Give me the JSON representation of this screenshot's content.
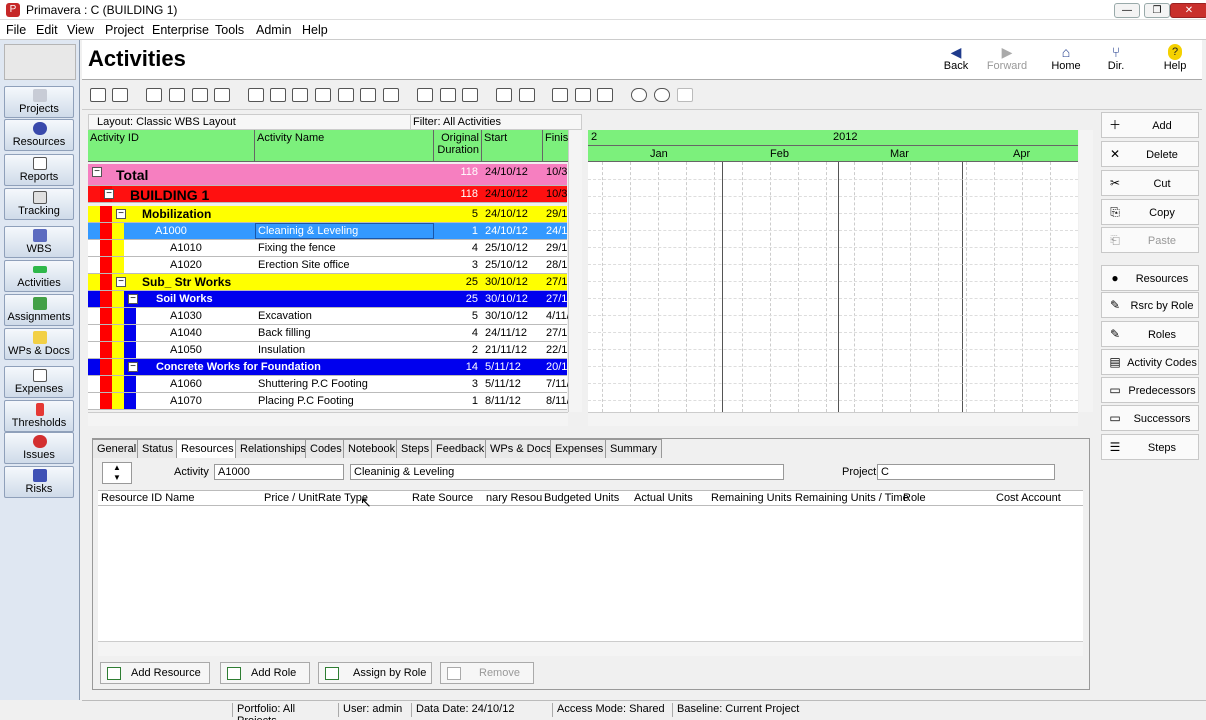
{
  "window": {
    "title": "Primavera : C (BUILDING 1)"
  },
  "menu": [
    "File",
    "Edit",
    "View",
    "Project",
    "Enterprise",
    "Tools",
    "Admin",
    "Help"
  ],
  "sidebar": [
    "Projects",
    "Resources",
    "Reports",
    "Tracking",
    "WBS",
    "Activities",
    "Assignments",
    "WPs & Docs",
    "Expenses",
    "Thresholds",
    "Issues",
    "Risks"
  ],
  "header": {
    "title": "Activities",
    "nav": [
      "Back",
      "Forward",
      "Home",
      "Dir.",
      "Help"
    ]
  },
  "layout": {
    "label": "Layout: Classic WBS Layout",
    "filter": "Filter: All Activities"
  },
  "grid": {
    "columns": [
      "Activity ID",
      "Activity Name",
      "Original Duration",
      "Start",
      "Finis"
    ],
    "rows": [
      {
        "id": "Total",
        "name": "",
        "dur": "118",
        "start": "24/10/12",
        "fin": "10/3"
      },
      {
        "id": "BUILDING 1",
        "name": "",
        "dur": "118",
        "start": "24/10/12",
        "fin": "10/3"
      },
      {
        "id": "Mobilization",
        "name": "",
        "dur": "5",
        "start": "24/10/12",
        "fin": "29/1"
      },
      {
        "id": "A1000",
        "name": "Cleaninig & Leveling",
        "dur": "1",
        "start": "24/10/12",
        "fin": "24/1"
      },
      {
        "id": "A1010",
        "name": "Fixing the fence",
        "dur": "4",
        "start": "25/10/12",
        "fin": "29/1"
      },
      {
        "id": "A1020",
        "name": "Erection Site office",
        "dur": "3",
        "start": "25/10/12",
        "fin": "28/1"
      },
      {
        "id": "Sub_ Str Works",
        "name": "",
        "dur": "25",
        "start": "30/10/12",
        "fin": "27/1"
      },
      {
        "id": "Soil Works",
        "name": "",
        "dur": "25",
        "start": "30/10/12",
        "fin": "27/1"
      },
      {
        "id": "A1030",
        "name": "Excavation",
        "dur": "5",
        "start": "30/10/12",
        "fin": "4/11/"
      },
      {
        "id": "A1040",
        "name": "Back filling",
        "dur": "4",
        "start": "24/11/12",
        "fin": "27/1"
      },
      {
        "id": "A1050",
        "name": "Insulation",
        "dur": "2",
        "start": "21/11/12",
        "fin": "22/1"
      },
      {
        "id": "Concrete Works for Foundation",
        "name": "",
        "dur": "14",
        "start": "5/11/12",
        "fin": "20/1"
      },
      {
        "id": "A1060",
        "name": "Shuttering P.C Footing",
        "dur": "3",
        "start": "5/11/12",
        "fin": "7/11/"
      },
      {
        "id": "A1070",
        "name": "Placing P.C Footing",
        "dur": "1",
        "start": "8/11/12",
        "fin": "8/11/"
      }
    ]
  },
  "gantt": {
    "year": "2012",
    "year_left": "2",
    "months": [
      "Jan",
      "Feb",
      "Mar",
      "Apr"
    ]
  },
  "detail": {
    "tabs": [
      "General",
      "Status",
      "Resources",
      "Relationships",
      "Codes",
      "Notebook",
      "Steps",
      "Feedback",
      "WPs & Docs",
      "Expenses",
      "Summary"
    ],
    "activity_label": "Activity",
    "activity_id": "A1000",
    "activity_name": "Cleaninig & Leveling",
    "project_label": "Project",
    "project": "C",
    "columns": [
      "Resource ID Name",
      "Price / Unit",
      "Rate Type",
      "Rate Source",
      "nary Resou",
      "Budgeted Units",
      "Actual Units",
      "Remaining Units",
      "Remaining Units / Time",
      "Role",
      "Cost Account"
    ],
    "buttons": [
      "Add Resource",
      "Add Role",
      "Assign by Role",
      "Remove"
    ]
  },
  "actions": [
    "Add",
    "Delete",
    "Cut",
    "Copy",
    "Paste",
    "Resources",
    "Rsrc by Role",
    "Roles",
    "Activity Codes",
    "Predecessors",
    "Successors",
    "Steps"
  ],
  "status": {
    "portfolio": "Portfolio: All Projects",
    "user": "User: admin",
    "date": "Data Date: 24/10/12",
    "access": "Access Mode: Shared",
    "baseline": "Baseline: Current Project"
  },
  "colors": {
    "total": "#f67fc0",
    "building": "#ff1010",
    "mobilization": "#ffff00",
    "soil": "#0000ee",
    "selected": "#3399ff",
    "green": "#7cf07c"
  }
}
